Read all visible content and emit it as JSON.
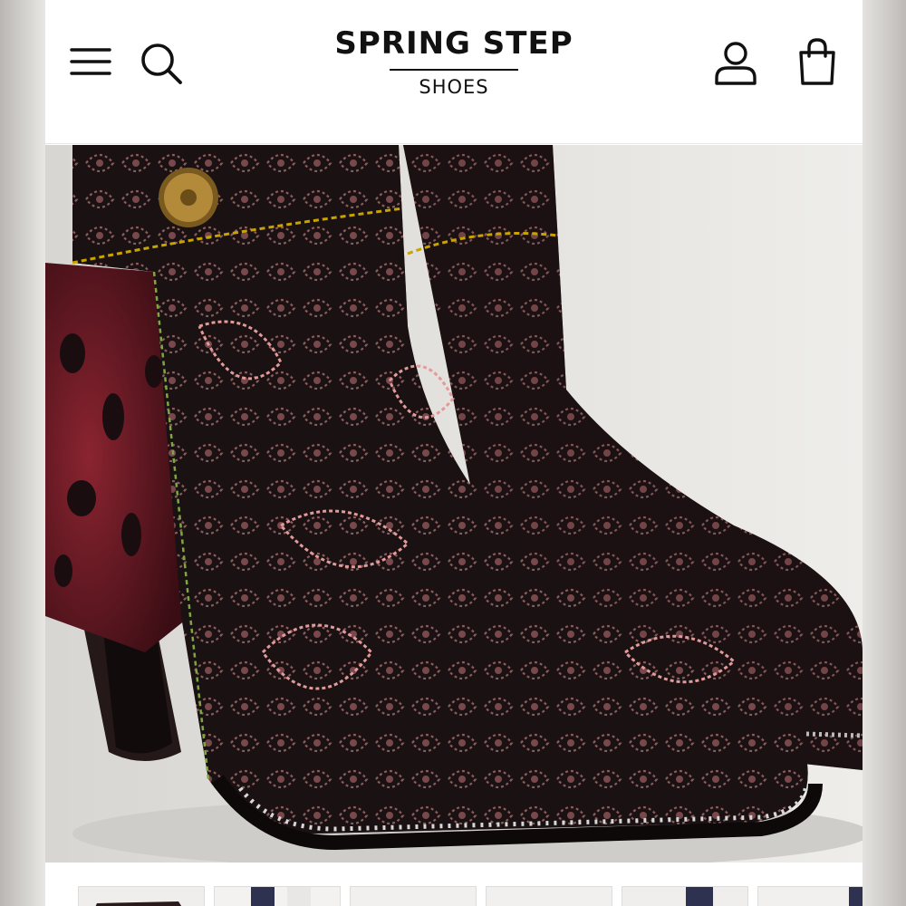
{
  "header": {
    "brand": "SPRING STEP",
    "sub_brand": "SHOES",
    "icons": [
      "menu-icon",
      "search-icon",
      "user-icon",
      "shopping-bag-icon"
    ]
  },
  "hero": {
    "subject": "boot-photo"
  },
  "thumbnails": {
    "count": 6
  },
  "colors": {
    "text": "#111111",
    "background": "#ffffff",
    "boot_black": "#1a1112",
    "boot_burgundy": "#6e1a24",
    "pattern_pink": "#d98c8c"
  }
}
